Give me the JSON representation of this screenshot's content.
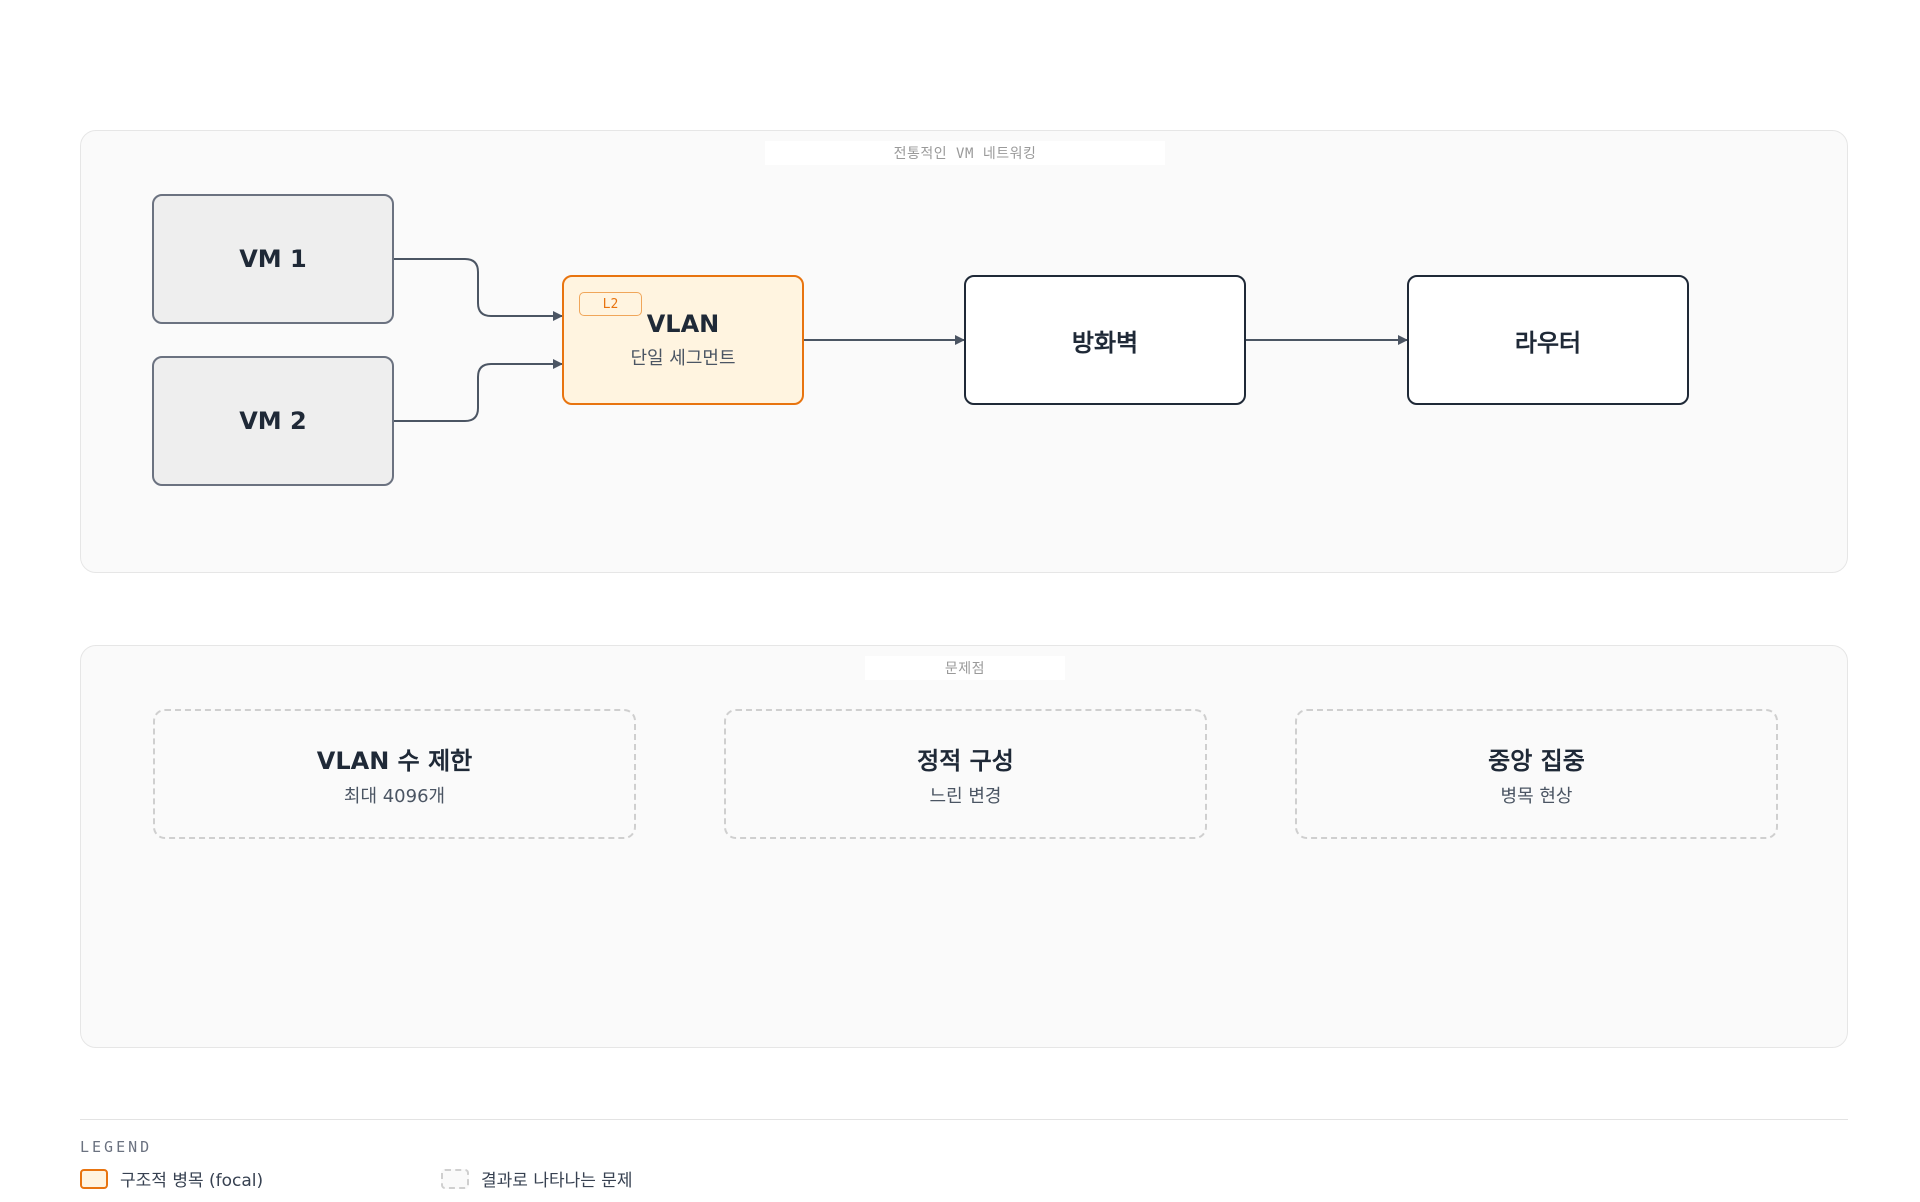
{
  "sections": {
    "top_label": "전통적인 VM 네트워킹",
    "bottom_label": "문제점"
  },
  "nodes": {
    "vm1": {
      "title": "VM 1"
    },
    "vm2": {
      "title": "VM 2"
    },
    "vlan": {
      "badge": "L2",
      "title": "VLAN",
      "sub": "단일 세그먼트"
    },
    "firewall": {
      "title": "방화벽"
    },
    "router": {
      "title": "라우터"
    }
  },
  "problems": [
    {
      "title": "VLAN 수 제한",
      "sub": "최대 4096개"
    },
    {
      "title": "정적 구성",
      "sub": "느린 변경"
    },
    {
      "title": "중앙 집중",
      "sub": "병목 현상"
    }
  ],
  "legend": {
    "title": "LEGEND",
    "items": [
      {
        "label": "구조적 병목 (focal)"
      },
      {
        "label": "결과로 나타나는 문제"
      }
    ]
  },
  "colors": {
    "focal_border": "#e8740f",
    "focal_fill": "#fff4e0",
    "edge": "#4b5563"
  }
}
